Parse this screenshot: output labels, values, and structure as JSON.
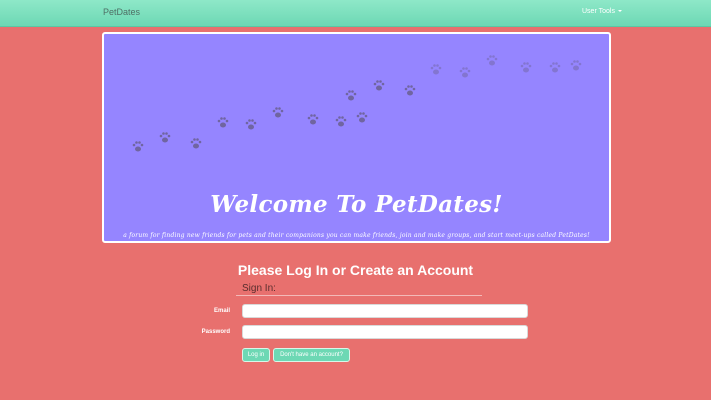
{
  "navbar": {
    "brand": "PetDates",
    "user_tools": "User Tools"
  },
  "hero": {
    "title": "Welcome To PetDates!",
    "subtitle": "a forum for finding new friends for pets and their companions you can make friends, join and make groups, and start meet-ups called PetDates!",
    "decoration_icon": "paw-print-icon"
  },
  "login": {
    "heading": "Please Log In or Create an Account",
    "section_label": "Sign In:",
    "email_label": "Email",
    "email_value": "",
    "password_label": "Password",
    "password_value": "",
    "login_button": "Log in",
    "signup_button": "Don't have an account?"
  },
  "colors": {
    "background": "#e8706e",
    "navbar": "#7fe0bf",
    "hero": "#9585ff",
    "button": "#6dd8b4"
  }
}
